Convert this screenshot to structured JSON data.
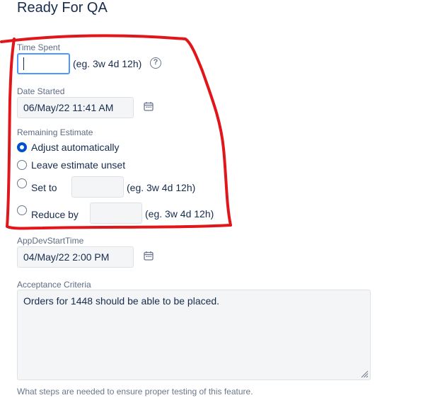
{
  "page": {
    "title": "Ready For QA"
  },
  "time_spent": {
    "label": "Time Spent",
    "value": "",
    "hint": "(eg. 3w 4d 12h)",
    "help_icon": "question-circle-icon"
  },
  "date_started": {
    "label": "Date Started",
    "value": "06/May/22 11:41 AM",
    "icon": "calendar-icon"
  },
  "remaining_estimate": {
    "label": "Remaining Estimate",
    "options": [
      {
        "label": "Adjust automatically",
        "checked": true
      },
      {
        "label": "Leave estimate unset",
        "checked": false
      },
      {
        "label": "Set to",
        "checked": false,
        "value": "",
        "hint": "(eg. 3w 4d 12h)"
      },
      {
        "label": "Reduce by",
        "checked": false,
        "value": "",
        "hint": "(eg. 3w 4d 12h)"
      }
    ]
  },
  "app_dev_start_time": {
    "label": "AppDevStartTime",
    "value": "04/May/22 2:00 PM",
    "icon": "calendar-icon"
  },
  "acceptance_criteria": {
    "label": "Acceptance Criteria",
    "value": "Orders for 1448 should be able to be placed.",
    "help_text": "What steps are needed to ensure proper testing of this feature."
  },
  "colors": {
    "annotation": "#e0161b",
    "focus": "#4c9aff",
    "radio_checked": "#0052cc"
  }
}
